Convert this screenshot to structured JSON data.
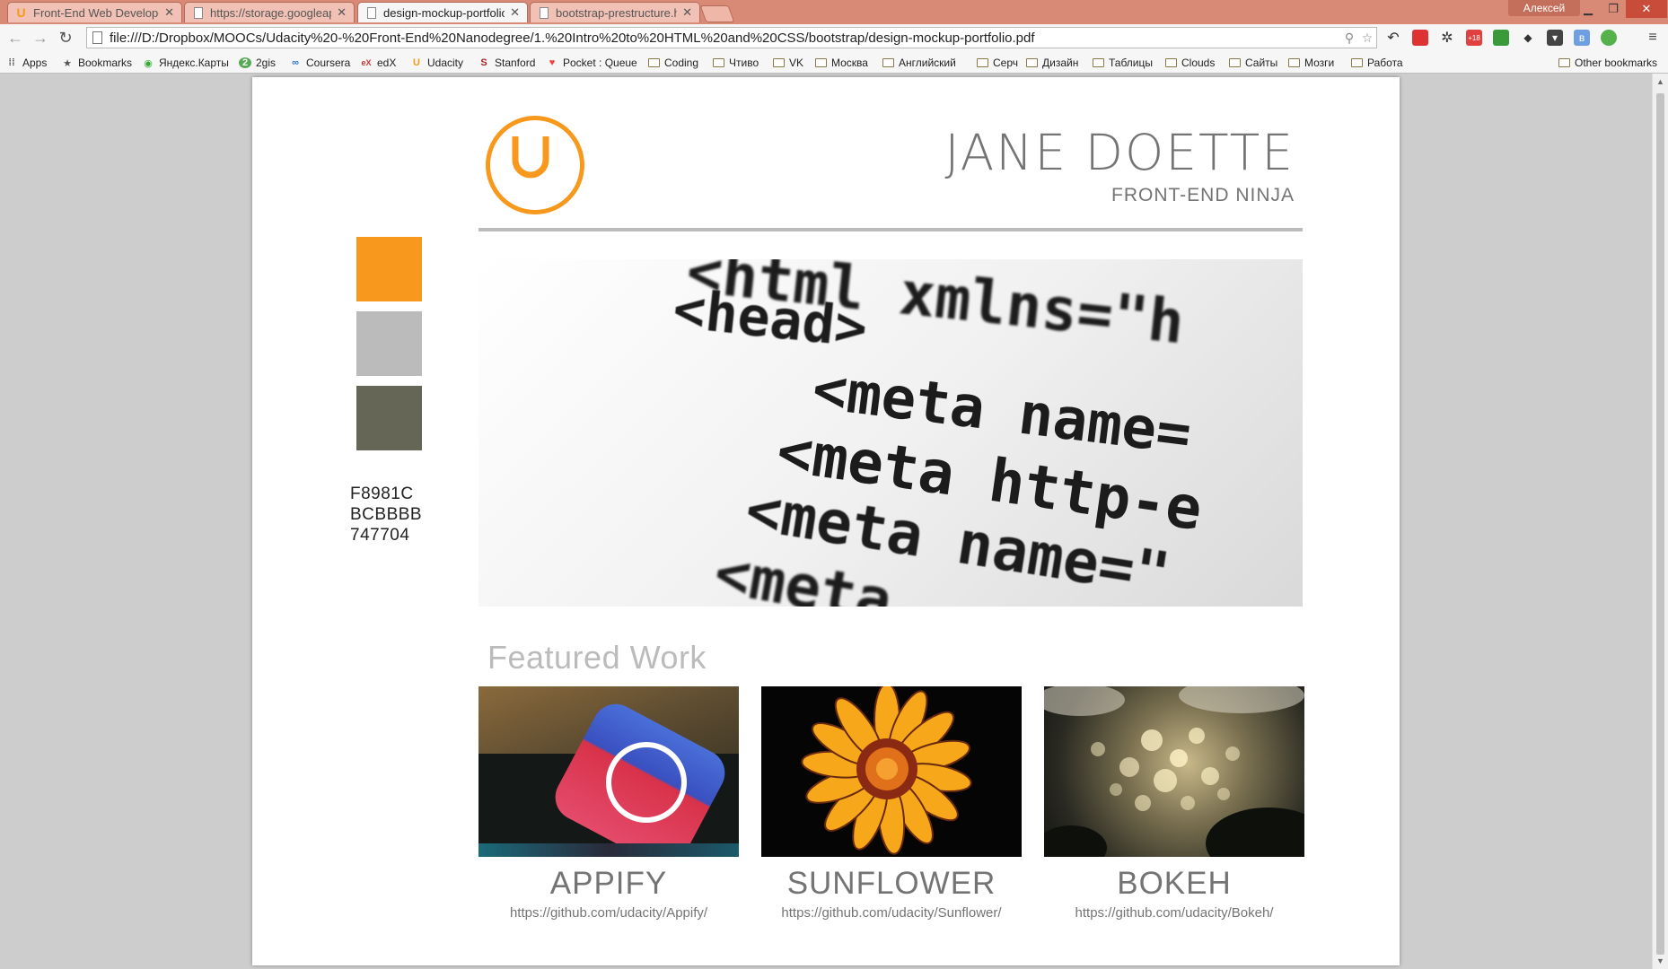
{
  "browser": {
    "tabs": [
      {
        "title": "Front-End Web Develope",
        "icon": "udacity-icon"
      },
      {
        "title": "https://storage.googleap",
        "icon": "page-icon"
      },
      {
        "title": "design-mockup-portfolio",
        "icon": "page-icon"
      },
      {
        "title": "bootstrap-prestructure.ht",
        "icon": "page-icon"
      }
    ],
    "user": "Алексей",
    "url": "file:///D:/Dropbox/MOOCs/Udacity%20-%20Front-End%20Nanodegree/1.%20Intro%20to%20HTML%20and%20CSS/bootstrap/design-mockup-portfolio.pdf",
    "bookmarks": [
      "Apps",
      "Bookmarks",
      "Яндекс.Карты",
      "2gis",
      "Coursera",
      "edX",
      "Udacity",
      "Stanford",
      "Pocket : Queue",
      "Coding",
      "Чтиво",
      "VK",
      "Москва",
      "Английский",
      "Серч",
      "Дизайн",
      "Таблицы",
      "Clouds",
      "Сайты",
      "Мозги",
      "Работа"
    ],
    "other_bookmarks": "Other bookmarks",
    "ext_badge": "+18"
  },
  "mockup": {
    "logo_letter": "U",
    "name": "JANE DOETTE",
    "subtitle": "FRONT-END NINJA",
    "palette": [
      {
        "hex": "F8981C",
        "color": "#F8981C"
      },
      {
        "hex": "BCBBBB",
        "color": "#BCBBBB"
      },
      {
        "hex": "747704",
        "color": "#666657"
      }
    ],
    "hero_code": [
      "<html xmlns=\"h",
      "<head>",
      "<meta name=",
      "<meta http-e",
      "<meta name=\"",
      "<meta"
    ],
    "featured_title": "Featured Work",
    "projects": [
      {
        "title": "APPIFY",
        "link": "https://github.com/udacity/Appify/",
        "image": "app-store-icon-photo"
      },
      {
        "title": "SUNFLOWER",
        "link": "https://github.com/udacity/Sunflower/",
        "image": "sunflower-photo"
      },
      {
        "title": "BOKEH",
        "link": "https://github.com/udacity/Bokeh/",
        "image": "bokeh-lights-photo"
      }
    ]
  }
}
